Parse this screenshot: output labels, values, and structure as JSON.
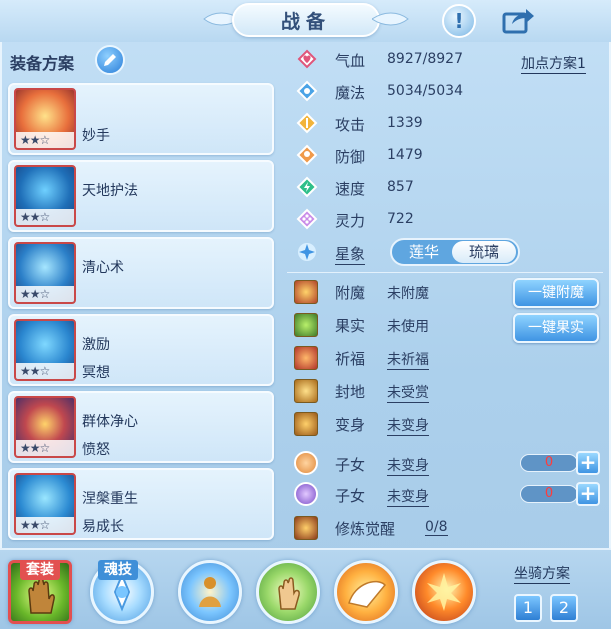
{
  "title": "战备",
  "equip_label": "装备方案",
  "equipment": [
    {
      "name": "妙手",
      "sub": "",
      "stars": "★★☆"
    },
    {
      "name": "天地护法",
      "sub": "",
      "stars": "★★☆"
    },
    {
      "name": "清心术",
      "sub": "",
      "stars": "★★☆"
    },
    {
      "name": "激励",
      "sub": "冥想",
      "stars": "★★☆"
    },
    {
      "name": "群体净心",
      "sub": "愤怒",
      "stars": "★★☆"
    },
    {
      "name": "涅槃重生",
      "sub": "易成长",
      "stars": "★★☆"
    }
  ],
  "stats": [
    {
      "label": "气血",
      "value": "8927/8927",
      "icon": "heart-icon",
      "color": "#e0567a"
    },
    {
      "label": "魔法",
      "value": "5034/5034",
      "icon": "mana-icon",
      "color": "#4aa3e6"
    },
    {
      "label": "攻击",
      "value": "1339",
      "icon": "attack-icon",
      "color": "#f2b43a"
    },
    {
      "label": "防御",
      "value": "1479",
      "icon": "defense-icon",
      "color": "#f09a4a"
    },
    {
      "label": "速度",
      "value": "857",
      "icon": "speed-icon",
      "color": "#2fbf8a"
    },
    {
      "label": "灵力",
      "value": "722",
      "icon": "spirit-icon",
      "color": "#c98be8"
    }
  ],
  "add_point_plan": "加点方案1",
  "xingxiang": {
    "label": "星象",
    "options": [
      "莲华",
      "琉璃"
    ],
    "selected": "琉璃"
  },
  "attributes": [
    {
      "label": "附魔",
      "value": "未附魔",
      "underline": false
    },
    {
      "label": "果实",
      "value": "未使用",
      "underline": false
    },
    {
      "label": "祈福",
      "value": "未祈福",
      "underline": true
    },
    {
      "label": "封地",
      "value": "未受赏",
      "underline": true
    },
    {
      "label": "变身",
      "value": "未变身",
      "underline": true
    },
    {
      "label": "子女",
      "value": "未变身",
      "underline": true,
      "count": "0"
    },
    {
      "label": "子女",
      "value": "未变身",
      "underline": true,
      "count": "0"
    },
    {
      "label": "修炼觉醒",
      "value": "0/8",
      "underline": true
    }
  ],
  "buttons": {
    "enchant": "一键附魔",
    "fruit": "一键果实"
  },
  "bottom": {
    "tag_suit": "套装",
    "tag_soul": "魂技",
    "mount_label": "坐骑方案",
    "mount_1": "1",
    "mount_2": "2"
  }
}
